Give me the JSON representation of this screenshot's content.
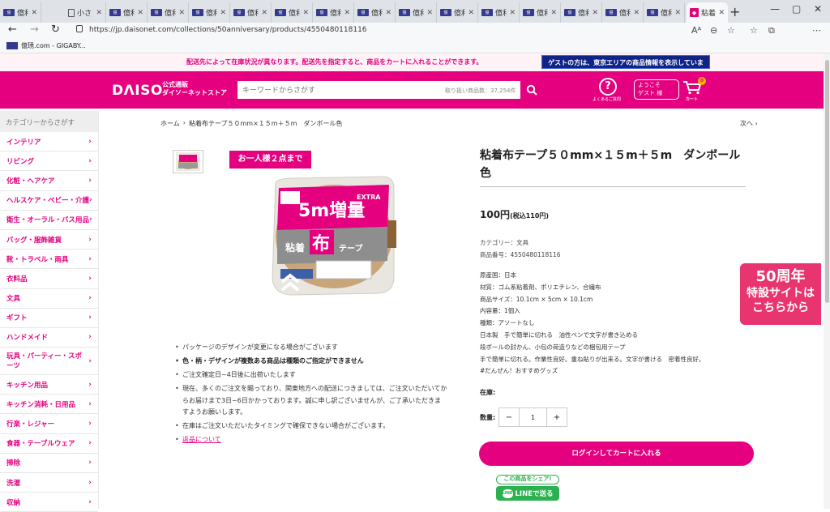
{
  "browser": {
    "tabs": [
      {
        "label": "億利"
      },
      {
        "label": "小さ"
      },
      {
        "label": "億利"
      },
      {
        "label": "億利"
      },
      {
        "label": "億利"
      },
      {
        "label": "億利"
      },
      {
        "label": "億利"
      },
      {
        "label": "億利"
      },
      {
        "label": "億利"
      },
      {
        "label": "億利"
      },
      {
        "label": "億利"
      },
      {
        "label": "億利"
      },
      {
        "label": "億利"
      },
      {
        "label": "億利"
      },
      {
        "label": "億利"
      },
      {
        "label": "億利"
      },
      {
        "label": "粘着"
      }
    ],
    "url": "https://jp.daisonet.com/collections/50anniversary/products/4550480118116",
    "favorites": [
      {
        "label": "億琇.com - GIGABY..."
      }
    ]
  },
  "site": {
    "notice": "配送先によって在庫状況が異なります。配送先を指定すると、商品をカートに入れることができます。",
    "guest_banner": "ゲストの方は、東京エリアの商品情報を表示しています。",
    "logo_text": "DΛISO",
    "logo_sub_1": "公式通販",
    "logo_sub_2": "ダイソーネットストア",
    "search_placeholder": "キーワードからさがす",
    "search_count": "取り扱い商品数：37,254件",
    "faq_label": "よくあるご質問",
    "welcome_1": "ようこそ",
    "welcome_2": "ゲスト 様",
    "cart_count": "0",
    "cart_label": "カート",
    "brand_color": "#e4007f"
  },
  "sidebar": {
    "title": "カテゴリーからさがす",
    "items": [
      {
        "label": "インテリア"
      },
      {
        "label": "リビング"
      },
      {
        "label": "化粧・ヘアケア"
      },
      {
        "label": "ヘルスケア・ベビー・介護"
      },
      {
        "label": "衛生・オーラル・バス用品"
      },
      {
        "label": "バッグ・服飾雑貨"
      },
      {
        "label": "靴・トラベル・雨具"
      },
      {
        "label": "衣料品"
      },
      {
        "label": "文具"
      },
      {
        "label": "ギフト"
      },
      {
        "label": "ハンドメイド"
      },
      {
        "label": "玩具・パーティー・スポーツ"
      },
      {
        "label": "キッチン用品"
      },
      {
        "label": "キッチン消耗・日用品"
      },
      {
        "label": "行楽・レジャー"
      },
      {
        "label": "食器・テーブルウェア"
      },
      {
        "label": "掃除"
      },
      {
        "label": "洗濯"
      },
      {
        "label": "収納"
      }
    ]
  },
  "breadcrumb": {
    "home": "ホーム",
    "sep": "›",
    "current": "粘着布テープ５０mm×１５m＋５m　ダンボール色",
    "next": "次へ ›"
  },
  "gallery": {
    "limit_badge": "お一人様２点まで"
  },
  "product": {
    "title": "粘着布テープ５０mm×１５m＋５m　ダンボール色",
    "price": "100円",
    "price_tax": "(税込110円)",
    "category": "カテゴリー：文具",
    "item_no": "商品番号：4550480118116",
    "spec_lines": [
      "原産国：日本",
      "材質：ゴム系粘着剤、ポリエチレン、合繊布",
      "商品サイズ：10.1cm × 5cm × 10.1cm",
      "内容量：1個入",
      "種類：アソートなし",
      "日本製　手で簡単に切れる　油性ペンで文字が書き込める",
      "段ボールの封かん、小包の荷造りなどの梱包用テープ",
      "手で簡単に切れる。作業性良好。重ね貼りが出来る。文字が書ける　密着性良好。",
      "#だんぜん！おすすめグッズ"
    ],
    "stock_label": "在庫:",
    "qty_label": "数量:",
    "qty_value": "1",
    "qty_minus": "−",
    "qty_plus": "+",
    "login_cart": "ログインしてカートに入れる",
    "share_bubble": "この商品をシェア!",
    "line_btn": "LINEで送る",
    "line_logo": "LINE"
  },
  "notes": [
    {
      "text": "パッケージのデザインが変更になる場合がございます"
    },
    {
      "text": "色・柄・デザインが複数ある商品は種類のご指定ができません"
    },
    {
      "text": "ご注文確定日~4日後に出荷いたします"
    },
    {
      "text": "現在、多くのご注文を賜っており、関東地方への配送につきましては、ご注文いただいてからお届けまで3日~6日かかっております。誠に申し訳ございませんが、ご了承いただきますようお願いします。"
    },
    {
      "text": "在庫はご注文いただいたタイミングで確保できない場合がございます。"
    },
    {
      "text": "返品について"
    }
  ],
  "anniversary": {
    "line1": "50周年",
    "line2": "特設サイトは",
    "line3": "こちらから"
  }
}
